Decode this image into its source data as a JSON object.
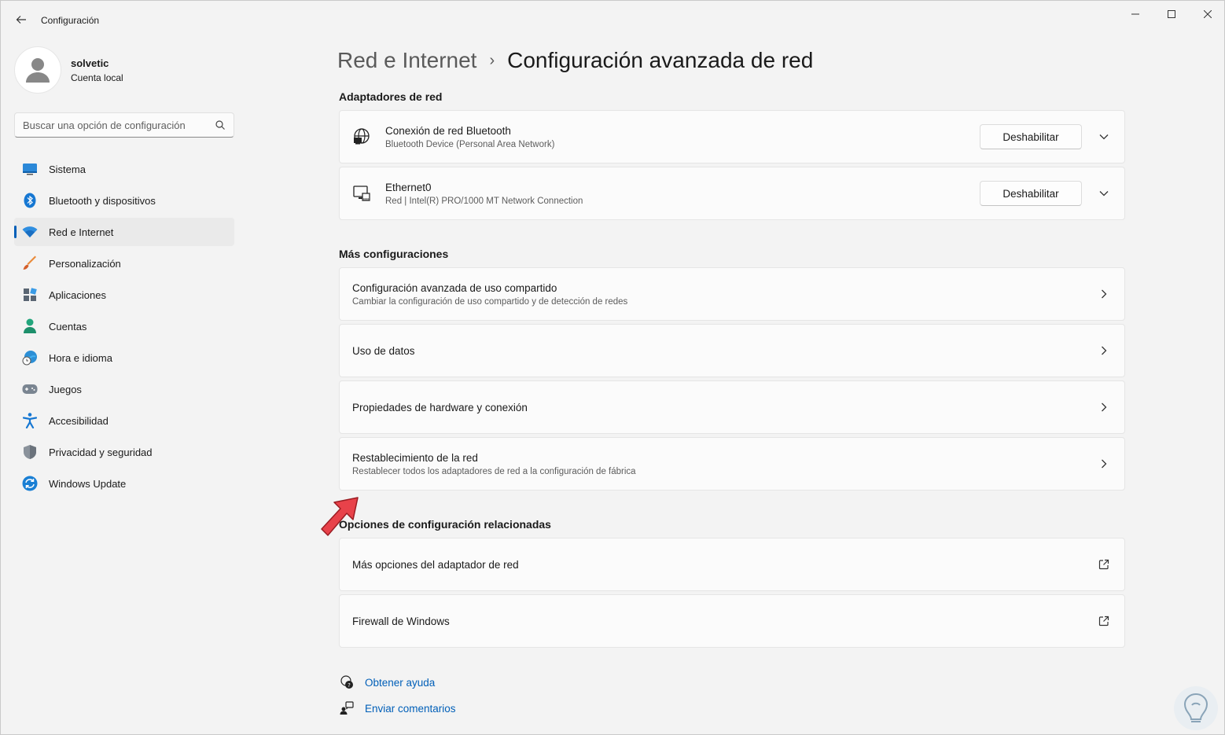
{
  "app": {
    "title": "Configuración"
  },
  "window_controls": {
    "minimize": "minimize-icon",
    "maximize": "maximize-icon",
    "close": "close-icon"
  },
  "profile": {
    "name": "solvetic",
    "account": "Cuenta local"
  },
  "search": {
    "placeholder": "Buscar una opción de configuración"
  },
  "sidebar": {
    "items": [
      {
        "label": "Sistema",
        "icon": "monitor-icon"
      },
      {
        "label": "Bluetooth y dispositivos",
        "icon": "bluetooth-icon"
      },
      {
        "label": "Red e Internet",
        "icon": "wifi-icon",
        "active": true
      },
      {
        "label": "Personalización",
        "icon": "brush-icon"
      },
      {
        "label": "Aplicaciones",
        "icon": "apps-icon"
      },
      {
        "label": "Cuentas",
        "icon": "person-icon"
      },
      {
        "label": "Hora e idioma",
        "icon": "globe-clock-icon"
      },
      {
        "label": "Juegos",
        "icon": "gamepad-icon"
      },
      {
        "label": "Accesibilidad",
        "icon": "accessibility-icon"
      },
      {
        "label": "Privacidad y seguridad",
        "icon": "shield-icon"
      },
      {
        "label": "Windows Update",
        "icon": "update-icon"
      }
    ]
  },
  "breadcrumb": {
    "parent": "Red e Internet",
    "separator": "›",
    "current": "Configuración avanzada de red"
  },
  "adapters": {
    "title": "Adaptadores de red",
    "items": [
      {
        "title": "Conexión de red Bluetooth",
        "subtitle": "Bluetooth Device (Personal Area Network)",
        "button": "Deshabilitar",
        "icon": "globe-network-icon"
      },
      {
        "title": "Ethernet0",
        "subtitle": "Red | Intel(R) PRO/1000 MT Network Connection",
        "button": "Deshabilitar",
        "icon": "ethernet-icon"
      }
    ]
  },
  "more": {
    "title": "Más configuraciones",
    "items": [
      {
        "title": "Configuración avanzada de uso compartido",
        "subtitle": "Cambiar la configuración de uso compartido y de detección de redes"
      },
      {
        "title": "Uso de datos",
        "subtitle": ""
      },
      {
        "title": "Propiedades de hardware y conexión",
        "subtitle": ""
      },
      {
        "title": "Restablecimiento de la red",
        "subtitle": "Restablecer todos los adaptadores de red a la configuración de fábrica"
      }
    ]
  },
  "related": {
    "title": "Opciones de configuración relacionadas",
    "items": [
      {
        "title": "Más opciones del adaptador de red"
      },
      {
        "title": "Firewall de Windows"
      }
    ]
  },
  "help": {
    "get_help": "Obtener ayuda",
    "feedback": "Enviar comentarios"
  },
  "colors": {
    "accent": "#005fb8",
    "highlight_arrow": "#e8424a"
  }
}
